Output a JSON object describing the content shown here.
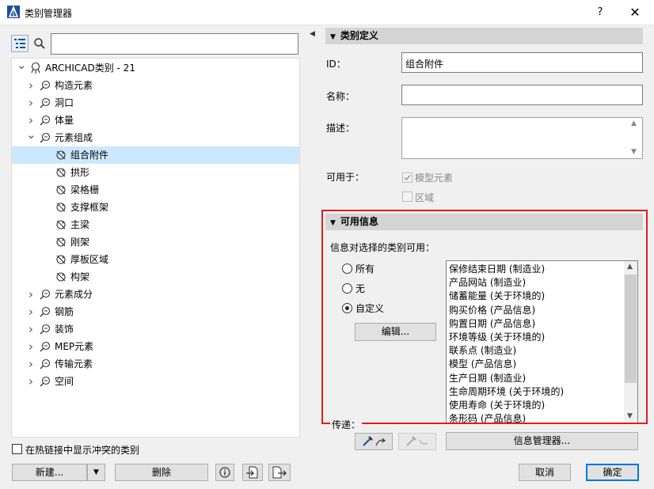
{
  "window": {
    "title": "类别管理器",
    "help_label": "?",
    "close_label": "✕"
  },
  "tree": {
    "root": {
      "label": "ARCHICAD类别 - 21"
    },
    "items": [
      {
        "label": "构造元素",
        "level": 1,
        "expanded": false
      },
      {
        "label": "洞口",
        "level": 1,
        "expanded": false
      },
      {
        "label": "体量",
        "level": 1,
        "expanded": false
      },
      {
        "label": "元素组成",
        "level": 1,
        "expanded": true
      },
      {
        "label": "组合附件",
        "level": 2,
        "selected": true
      },
      {
        "label": "拱形",
        "level": 2
      },
      {
        "label": "梁格栅",
        "level": 2
      },
      {
        "label": "支撑框架",
        "level": 2
      },
      {
        "label": "主梁",
        "level": 2
      },
      {
        "label": "刚架",
        "level": 2
      },
      {
        "label": "厚板区域",
        "level": 2
      },
      {
        "label": "构架",
        "level": 2
      },
      {
        "label": "元素成分",
        "level": 1,
        "expanded": false
      },
      {
        "label": "钢筋",
        "level": 1,
        "expanded": false
      },
      {
        "label": "装饰",
        "level": 1,
        "expanded": false
      },
      {
        "label": "MEP元素",
        "level": 1,
        "expanded": false
      },
      {
        "label": "传输元素",
        "level": 1,
        "expanded": false
      },
      {
        "label": "空间",
        "level": 1,
        "expanded": false
      }
    ]
  },
  "left_footer": {
    "show_conflicts_label": "在热链接中显示冲突的类别",
    "new_label": "新建...",
    "delete_label": "删除"
  },
  "definition": {
    "header": "类别定义",
    "id_label": "ID：",
    "id_value": "组合附件",
    "name_label": "名称：",
    "name_value": "",
    "desc_label": "描述：",
    "desc_value": "",
    "available_label": "可用于：",
    "model_elements_label": "模型元素",
    "zones_label": "区域"
  },
  "info": {
    "header": "可用信息",
    "subtitle": "信息对选择的类别可用：",
    "radio_all": "所有",
    "radio_none": "无",
    "radio_custom": "自定义",
    "edit_label": "编辑...",
    "items": [
      "保修结束日期 (制造业)",
      "产品网站 (制造业)",
      "储蓄能量 (关于环境的)",
      "购买价格 (产品信息)",
      "购置日期 (产品信息)",
      "环境等级 (关于环境的)",
      "联系点 (制造业)",
      "模型 (产品信息)",
      "生产日期 (制造业)",
      "生命周期环境 (关于环境的)",
      "使用寿命 (关于环境的)",
      "条形码 (产品信息)"
    ]
  },
  "transfer": {
    "label": "传递：",
    "info_manager_label": "信息管理器..."
  },
  "footer": {
    "cancel_label": "取消",
    "ok_label": "确定"
  },
  "colors": {
    "selection": "#cce8ff",
    "highlight": "#e41b1b",
    "section_header": "#d4d4d4"
  }
}
